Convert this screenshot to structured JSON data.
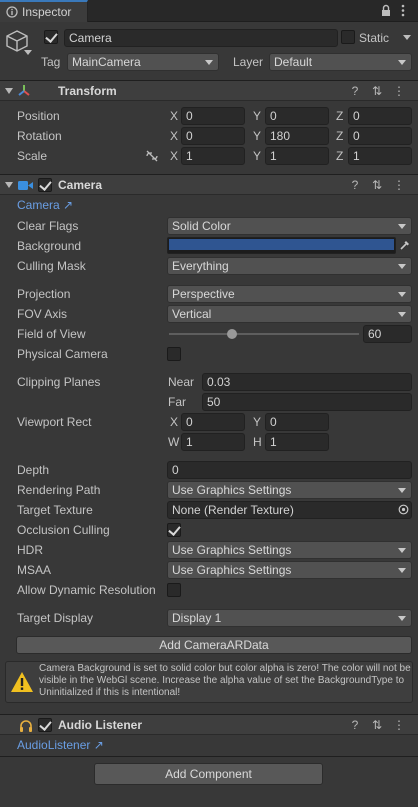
{
  "tab": {
    "label": "Inspector"
  },
  "object": {
    "name": "Camera",
    "static_label": "Static",
    "tag_label": "Tag",
    "tag_value": "MainCamera",
    "layer_label": "Layer",
    "layer_value": "Default"
  },
  "transform": {
    "title": "Transform",
    "position": {
      "label": "Position",
      "x": "0",
      "y": "0",
      "z": "0"
    },
    "rotation": {
      "label": "Rotation",
      "x": "0",
      "y": "180",
      "z": "0"
    },
    "scale": {
      "label": "Scale",
      "x": "1",
      "y": "1",
      "z": "1"
    }
  },
  "axes": {
    "x": "X",
    "y": "Y",
    "z": "Z",
    "w": "W",
    "h": "H"
  },
  "camera": {
    "title": "Camera",
    "link": "Camera",
    "clear_flags": {
      "label": "Clear Flags",
      "value": "Solid Color"
    },
    "background": {
      "label": "Background",
      "color": "#2f5591"
    },
    "culling_mask": {
      "label": "Culling Mask",
      "value": "Everything"
    },
    "projection": {
      "label": "Projection",
      "value": "Perspective"
    },
    "fov_axis": {
      "label": "FOV Axis",
      "value": "Vertical"
    },
    "field_of_view": {
      "label": "Field of View",
      "value": "60",
      "fraction": 0.33
    },
    "physical_camera": {
      "label": "Physical Camera"
    },
    "clipping_planes": {
      "label": "Clipping Planes",
      "near_label": "Near",
      "near": "0.03",
      "far_label": "Far",
      "far": "50"
    },
    "viewport_rect": {
      "label": "Viewport Rect",
      "x": "0",
      "y": "0",
      "w": "1",
      "h": "1"
    },
    "depth": {
      "label": "Depth",
      "value": "0"
    },
    "rendering_path": {
      "label": "Rendering Path",
      "value": "Use Graphics Settings"
    },
    "target_texture": {
      "label": "Target Texture",
      "value": "None (Render Texture)"
    },
    "occlusion_culling": {
      "label": "Occlusion Culling"
    },
    "hdr": {
      "label": "HDR",
      "value": "Use Graphics Settings"
    },
    "msaa": {
      "label": "MSAA",
      "value": "Use Graphics Settings"
    },
    "allow_dynamic_resolution": {
      "label": "Allow Dynamic Resolution"
    },
    "target_display": {
      "label": "Target Display",
      "value": "Display 1"
    },
    "add_ar_button": "Add CameraARData",
    "warning": "Camera Background is set to solid color but color alpha is zero! The color will not be visible in the WebGl scene. Increase the alpha value of set the BackgroundType to Uninitialized if this is intentional!"
  },
  "audio_listener": {
    "title": "Audio Listener",
    "link": "AudioListener"
  },
  "add_component_button": "Add Component",
  "colors": {
    "accent": "#3a79bb",
    "link": "#6a9ee4",
    "panel": "#383838"
  }
}
